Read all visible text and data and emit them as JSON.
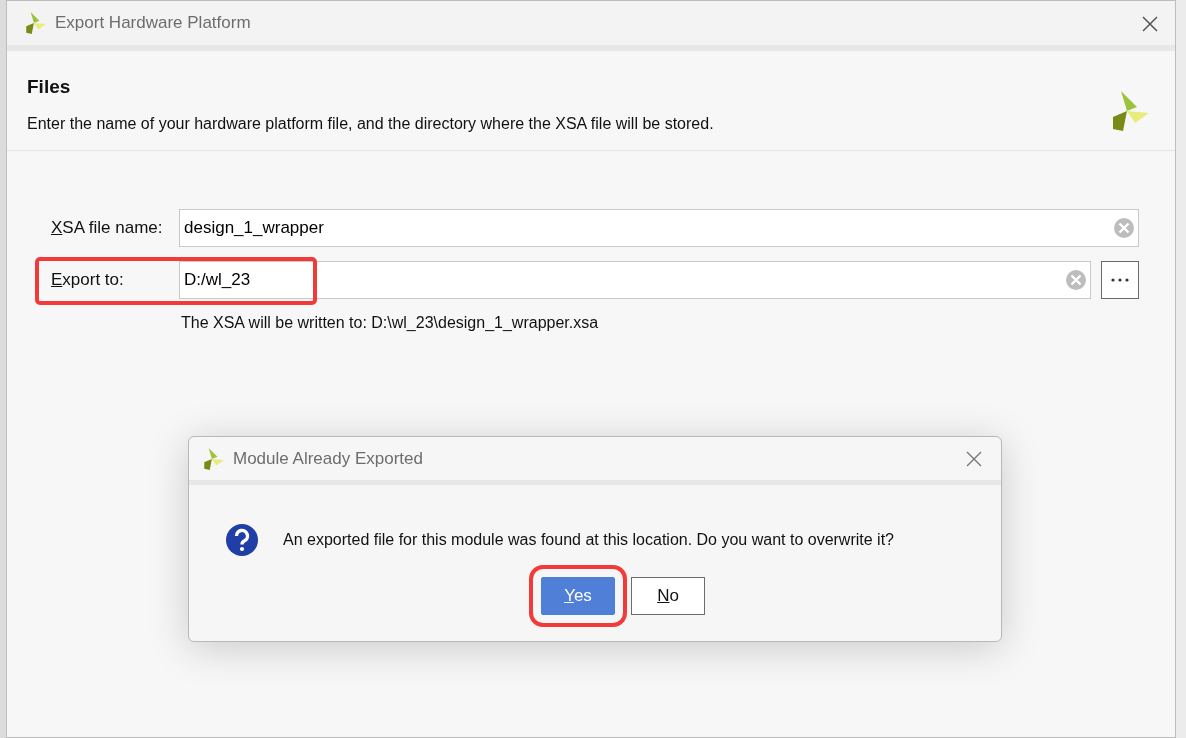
{
  "window": {
    "title": "Export Hardware Platform"
  },
  "header": {
    "title": "Files",
    "description": "Enter the name of your hardware platform file, and the directory where the XSA file will be stored."
  },
  "fields": [
    {
      "label": "XSA file name:",
      "mnemonic": true,
      "value": "design_1_wrapper",
      "browse": false,
      "highlighted": false
    },
    {
      "label": "Export to:",
      "mnemonic": true,
      "value": "D:/wl_23",
      "browse": true,
      "highlighted": true
    }
  ],
  "output_note": "The XSA will be written to: D:\\wl_23\\design_1_wrapper.xsa",
  "modal": {
    "title": "Module Already Exported",
    "message": "An exported file for this module was found at this location. Do you want to overwrite it?",
    "buttons": [
      {
        "label": "Yes",
        "mnemonic": true,
        "selected": true,
        "highlighted": true
      },
      {
        "label": "No",
        "mnemonic": true,
        "selected": false,
        "highlighted": false
      }
    ]
  }
}
